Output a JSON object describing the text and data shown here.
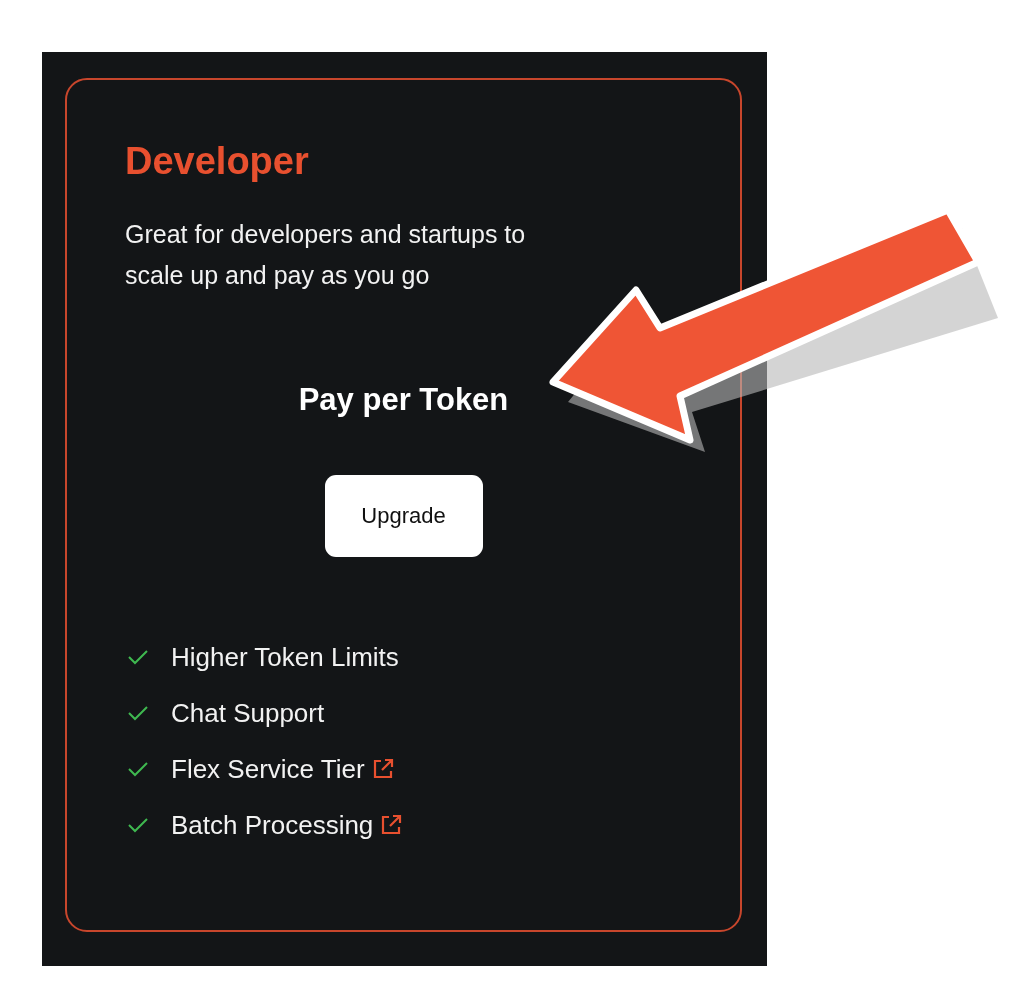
{
  "plan": {
    "title": "Developer",
    "description": "Great for developers and startups to scale up and pay as you go",
    "price": "Pay per Token",
    "button": "Upgrade",
    "features": [
      {
        "label": "Higher Token Limits",
        "external_link": false
      },
      {
        "label": "Chat Support",
        "external_link": false
      },
      {
        "label": "Flex Service Tier",
        "external_link": true
      },
      {
        "label": "Batch Processing",
        "external_link": true
      }
    ]
  }
}
